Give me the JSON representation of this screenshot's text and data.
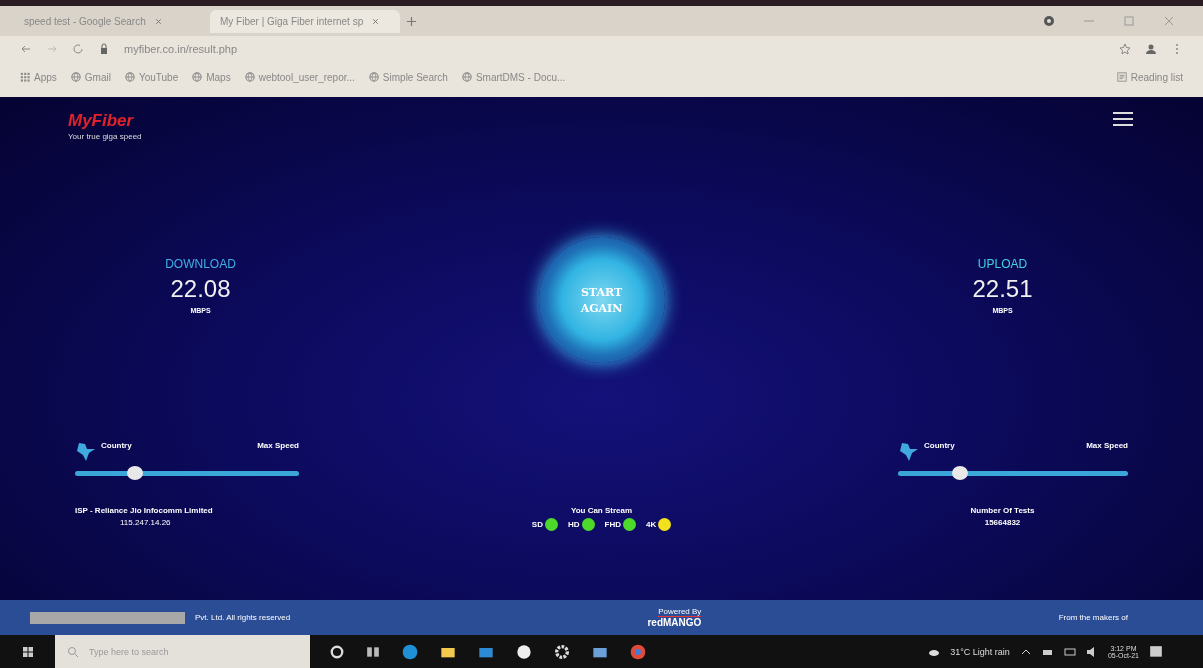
{
  "browser": {
    "tabs": [
      {
        "title": "speed test - Google Search",
        "selected": false
      },
      {
        "title": "My Fiber | Giga Fiber internet sp",
        "selected": true
      }
    ],
    "address": "myfiber.co.in/result.php",
    "bookmarks": [
      "Apps",
      "Gmail",
      "YouTube",
      "Maps",
      "webtool_user_repor...",
      "Simple Search",
      "SmartDMS - Docu..."
    ],
    "reading_list": "Reading list"
  },
  "header": {
    "logo": "MyFiber",
    "tagline": "Your true giga speed"
  },
  "download": {
    "label": "DOWNLOAD",
    "value": "22.08",
    "unit": "MBPS",
    "country_label": "Country",
    "max_label": "Max Speed",
    "level": 0.27
  },
  "upload": {
    "label": "UPLOAD",
    "value": "22.51",
    "unit": "MBPS",
    "country_label": "Country",
    "max_label": "Max Speed",
    "level": 0.27
  },
  "start_button": [
    "START",
    "AGAIN"
  ],
  "isp": {
    "name": "ISP - Reliance Jio Infocomm Limited",
    "ip": "115.247.14.26"
  },
  "stream": {
    "title": "You Can Stream",
    "items": [
      {
        "label": "SD",
        "color": "#4cd92a"
      },
      {
        "label": "HD",
        "color": "#4cd92a"
      },
      {
        "label": "FHD",
        "color": "#4cd92a"
      },
      {
        "label": "4K",
        "color": "#f2e21c"
      }
    ]
  },
  "tests": {
    "label": "Number Of Tests",
    "value": "15664832"
  },
  "footer": {
    "copyright": "Pvt. Ltd. All rights reserved",
    "powered_by": "Powered By",
    "brand": "redMANGO",
    "makers": "From the makers of"
  },
  "taskbar": {
    "search_placeholder": "Type here to search",
    "weather": "31°C Light rain",
    "time": "3:12 PM",
    "date": "05-Oct-21"
  }
}
